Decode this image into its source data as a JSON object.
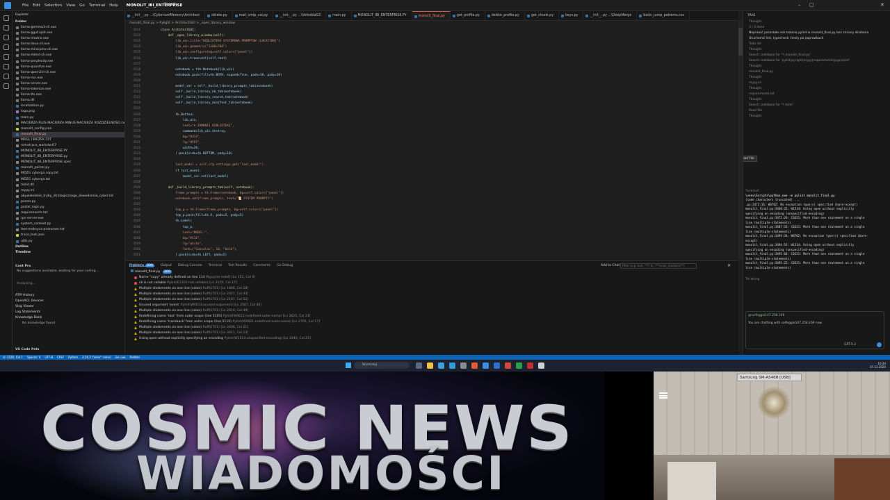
{
  "titlebar": {
    "menus": [
      "File",
      "Edit",
      "Selection",
      "View",
      "Go",
      "Terminal",
      "Help"
    ],
    "project": "MONOLIT_IBI_ENTERPRISE",
    "search": "Search"
  },
  "explorer": {
    "header": "Explorer",
    "folder": "Folder",
    "files": [
      {
        "name": "llama-gemma3-cli.exe",
        "color": "#7a7a7a"
      },
      {
        "name": "llama-gguf-split.exe",
        "color": "#7a7a7a"
      },
      {
        "name": "llama-imatrix.exe",
        "color": "#7a7a7a"
      },
      {
        "name": "llama-llava-cli.exe",
        "color": "#7a7a7a"
      },
      {
        "name": "llama-minicpmv-cli.exe",
        "color": "#7a7a7a"
      },
      {
        "name": "llama-mtmd-cli.exe",
        "color": "#7a7a7a"
      },
      {
        "name": "llama-perplexity.exe",
        "color": "#7a7a7a"
      },
      {
        "name": "llama-quantize.exe",
        "color": "#7a7a7a"
      },
      {
        "name": "llama-qwen2vl-cli.exe",
        "color": "#7a7a7a"
      },
      {
        "name": "llama-run.exe",
        "color": "#7a7a7a"
      },
      {
        "name": "llama-server.exe",
        "color": "#7a7a7a"
      },
      {
        "name": "llama-tokenize.exe",
        "color": "#7a7a7a"
      },
      {
        "name": "llama-tts.exe",
        "color": "#7a7a7a"
      },
      {
        "name": "llama.dll",
        "color": "#7a7a7a"
      },
      {
        "name": "localization.py",
        "color": "#3572a5"
      },
      {
        "name": "logo.png",
        "color": "#a074c4"
      },
      {
        "name": "main.py",
        "color": "#3572a5"
      },
      {
        "name": "MACIERZA PLUS MACIERZA MINUS MACIERZA ROZDZIELNOŚCI.txt",
        "color": "#888"
      },
      {
        "name": "monolit_config.json",
        "color": "#cbcb41"
      },
      {
        "name": "monolit_final.py",
        "color": "#3572a5",
        "selected": true
      },
      {
        "name": "MRGL I BIEŻEK.TXT",
        "color": "#888"
      },
      {
        "name": "mmatryca_wartstw.ft7",
        "color": "#888"
      },
      {
        "name": "MONOLIT_IBI_ENTERPRISE.PY",
        "color": "#3572a5"
      },
      {
        "name": "MONOLIT_IBI_ENTERPRISE.py",
        "color": "#3572a5"
      },
      {
        "name": "MONOLIT_IBI_ENTERPRISE.spec",
        "color": "#888"
      },
      {
        "name": "monolit_parser.py",
        "color": "#3572a5"
      },
      {
        "name": "MÓZG cyborga copy.txt",
        "color": "#888"
      },
      {
        "name": "MÓZG cyborga.txt",
        "color": "#888"
      },
      {
        "name": "mmd.dll",
        "color": "#7a7a7a"
      },
      {
        "name": "mypy.ini",
        "color": "#888"
      },
      {
        "name": "obywatelskie_tryby_strategicznego_dowodzenia_cyber.txt",
        "color": "#888"
      },
      {
        "name": "parser.py",
        "color": "#3572a5"
      },
      {
        "name": "portal_logic.py",
        "color": "#3572a5"
      },
      {
        "name": "requirements.txt",
        "color": "#888"
      },
      {
        "name": "rpc-server.exe",
        "color": "#7a7a7a"
      },
      {
        "name": "system_context.py",
        "color": "#3572a5"
      },
      {
        "name": "test-maksyca-prezunwe.txt",
        "color": "#888"
      },
      {
        "name": "trace_test.json",
        "color": "#cbcb41"
      },
      {
        "name": "utils.py",
        "color": "#3572a5"
      }
    ],
    "outline": "Outline",
    "timeline": "Timeline"
  },
  "copilot": {
    "header": "Cont Pro",
    "message": "No suggestions available, waiting for your coding...",
    "analyzing": "Analyzing...",
    "sections": [
      "ATPI History",
      "OpenACL Devices",
      "Slog Viewer",
      "Log Statements",
      "Knowledge Bank"
    ],
    "knowledge_empty": "No knowledge found",
    "footer": "VS Code Pets"
  },
  "tabs": [
    "__init__.py ...\\CyberiumMemory\\Architect",
    "delete.py",
    "mail_smtp_cal.py",
    "__init__.py ...\\VettoblaG3",
    "main.py",
    "MONOLIT_IBI_ENTERPRISE.PY",
    "monolit_final.py",
    "get_profile.py",
    "delete_profile.py",
    "get_chunk.py",
    "keys.py",
    "__init__.py ...\\DeepMerge",
    "basic_jump_patterns.css"
  ],
  "active_tab_index": 6,
  "breadcrumb": "monolit_final.py > Pylight > ArchitectGUI > _open_library_window",
  "editor": {
    "lines": [
      {
        "n": "3511",
        "t": "        class ArchitectGUI:"
      },
      {
        "n": "3512",
        "t": "            def _open_library_window(self):"
      },
      {
        "n": "3513",
        "t": "                lib_win.title(\"BIBLIOTEKA SYSTEMOWA PROMPTÓW [LOCATION]\")"
      },
      {
        "n": "3514",
        "t": "                lib_win.geometry(\"1100x700\")"
      },
      {
        "n": "3515",
        "t": "                lib_win.configure(bg=self.colors[\"panel\"])"
      },
      {
        "n": "3516",
        "t": "                lib_win.transient(self.root)"
      },
      {
        "n": "3517",
        "t": ""
      },
      {
        "n": "3518",
        "t": "                notebook = ttk.Notebook(lib_win)"
      },
      {
        "n": "3519",
        "t": "                notebook.pack(fill=tk.BOTH, expand=True, padx=10, pady=10)"
      },
      {
        "n": "3520",
        "t": ""
      },
      {
        "n": "3521",
        "t": "                model_var = self._build_library_prompts_tab(notebook)"
      },
      {
        "n": "3522",
        "t": "                self._build_library_kb_tab(notebook)"
      },
      {
        "n": "3523",
        "t": "                self._build_library_search_tab(notebook)"
      },
      {
        "n": "3524",
        "t": "                self._build_library_manifest_tab(notebook)"
      },
      {
        "n": "3525",
        "t": ""
      },
      {
        "n": "3526",
        "t": "                tk.Button("
      },
      {
        "n": "3527",
        "t": "                    lib_win,"
      },
      {
        "n": "3528",
        "t": "                    text=\"✖ ZAMKNIJ BIBLIOTEKĘ\","
      },
      {
        "n": "3529",
        "t": "                    command=lib_win.destroy,"
      },
      {
        "n": "3530",
        "t": "                    bg=\"#333\","
      },
      {
        "n": "3531",
        "t": "                    fg=\"#FFF\","
      },
      {
        "n": "3532",
        "t": "                    width=20,"
      },
      {
        "n": "3533",
        "t": "                ).pack(side=tk.BOTTOM, pady=10)"
      },
      {
        "n": "3534",
        "t": ""
      },
      {
        "n": "3535",
        "t": "                last_model = self.cfg.settings.get(\"last_model\")"
      },
      {
        "n": "3536",
        "t": "                if last_model:"
      },
      {
        "n": "3537",
        "t": "                    model_var.set(last_model)"
      },
      {
        "n": "3538",
        "t": ""
      },
      {
        "n": "3539",
        "t": "            def _build_library_prompts_tab(self, notebook):"
      },
      {
        "n": "3540",
        "t": "                frame_prompts = tk.Frame(notebook, bg=self.colors[\"panel\"])"
      },
      {
        "n": "3541",
        "t": "                notebook.add(frame_prompts, text=\"📜 SYSTEM PROMPTY\")"
      },
      {
        "n": "3542",
        "t": ""
      },
      {
        "n": "3543",
        "t": "                top_p = tk.Frame(frame_prompts, bg=self.colors[\"panel\"])"
      },
      {
        "n": "3544",
        "t": "                top_p.pack(fill=tk.X, padx=5, pady=5)"
      },
      {
        "n": "3545",
        "t": "                tk.Label("
      },
      {
        "n": "3546",
        "t": "                    top_p,"
      },
      {
        "n": "3547",
        "t": "                    text=\"MODEL:\","
      },
      {
        "n": "3548",
        "t": "                    bg=\"#111\","
      },
      {
        "n": "3549",
        "t": "                    fg=\"white\","
      },
      {
        "n": "3550",
        "t": "                    font=(\"Consolas\", 10, \"bold\"),"
      },
      {
        "n": "3551",
        "t": "                ).pack(side=tk.LEFT, padx=5)"
      }
    ]
  },
  "panel": {
    "tabs": [
      "Problems",
      "Output",
      "Debug Console",
      "Terminal",
      "Test Results",
      "Comments",
      "Go Debug"
    ],
    "problem_count": "200",
    "add_to_chat": "Add to Chat",
    "filter_placeholder": "Filter (e.g. text, **/*.ts, !**/node_modules/**)",
    "file_header": "monolit_final.py",
    "file_count": "200",
    "problems": [
      {
        "sev": "err",
        "msg": "Name \"copy\" already defined on line 114",
        "meta": "Mypy(no-redef) [Ln 152, Col 9]"
      },
      {
        "sev": "err",
        "msg": "cb is not callable",
        "meta": "Pylint(E1102:not-callable) [Ln 2070, Col 17]"
      },
      {
        "sev": "warn",
        "msg": "Multiple statements on one line (colon)",
        "meta": "Ruff(E701) [Ln 1866, Col 28]"
      },
      {
        "sev": "warn",
        "msg": "Multiple statements on one line (colon)",
        "meta": "Ruff(E701) [Ln 2007, Col 44]"
      },
      {
        "sev": "warn",
        "msg": "Multiple statements on one line (colon)",
        "meta": "Ruff(E701) [Ln 2197, Col 52]"
      },
      {
        "sev": "warn",
        "msg": "Unused argument 'event'",
        "meta": "Pylint(W0613:unused-argument) [Ln 2587, Col 40]"
      },
      {
        "sev": "warn",
        "msg": "Multiple statements on one line (colon)",
        "meta": "Ruff(E701) [Ln 2610, Col 49]"
      },
      {
        "sev": "warn",
        "msg": "Redefining name 'root' from outer scope (line 5105)",
        "meta": "Pylint(W0621:redefined-outer-name) [Ln 2625, Col 23]"
      },
      {
        "sev": "warn",
        "msg": "Redefining name 'traceback' from outer scope (line 5115)",
        "meta": "Pylint(W0621:redefined-outer-name) [Ln 2705, Col 17]"
      },
      {
        "sev": "warn",
        "msg": "Multiple statements on one line (colon)",
        "meta": "Ruff(E701) [Ln 3406, Col 21]"
      },
      {
        "sev": "warn",
        "msg": "Multiple statements on one line (colon)",
        "meta": "Ruff(E701) [Ln 3421, Col 24]"
      },
      {
        "sev": "warn",
        "msg": "Using open without explicitly specifying an encoding",
        "meta": "Pylint(W1514:unspecified-encoding) [Ln 3440, Col 25]"
      }
    ]
  },
  "chat": {
    "header": "TRAE",
    "lines": [
      "Thought",
      "3 / 3 done",
      "Naprawić pozostałe ostrzeżenia pylint w monolit_final.py bez zmiany działania",
      "Uruchomić lint, typecheck i testy po poprawkach",
      "Todo list",
      "Thought",
      "Search codebase for '*\\.monolit_final.py'",
      "Search codebase for 'pylint|pyright|mypy|requirements|pyproject'",
      "Thought",
      "monolit_final.py",
      "Thought",
      "mypy.ini",
      "Thought",
      "requirements.txt",
      "Thought",
      "Search codebase for '*\\.toml'",
      "Read file",
      "Thought"
    ],
    "term_title": "Terminal",
    "term_cmd": "\\venv\\Scripts\\python.exe -m pylint monolit_final.py",
    "term_lines": [
      "(some characters truncated) ...",
      ".py:3472:16: W0702: No exception type(s) specified (bare-except)",
      "monolit_final.py:3460:25: W1514: Using open without explicitly",
      "specifying an encoding (unspecified-encoding)",
      "monolit_final.py:3472:26: C0321: More than one statement on a single",
      "line (multiple-statements)",
      "monolit_final.py:3487:33: C0321: More than one statement on a single",
      "line (multiple-statements)",
      "monolit_final.py:3494:34: W0702: No exception type(s) specified (bare-",
      "except)",
      "monolit_final.py:3494:55: W1514: Using open without explicitly",
      "specifying an encoding (unspecified-encoding)",
      "monolit_final.py:3495:64: C0321: More than one statement on a single",
      "line (multiple-statements)",
      "monolit_final.py:3495:22: C0321: More than one statement on a single",
      "line (multiple-statements)"
    ],
    "thinking": "Thinking",
    "tooltip": "Read File",
    "account": "@solfeggio147.258.169",
    "chatting": "You are chatting with solfeggio147.258.169 now",
    "model": "GPT-5.2"
  },
  "statusbar": [
    "Ln 3520, Col 1",
    "Spaces: 4",
    "UTF-8",
    "CRLF",
    "Python",
    "3.14.2 ('venv': venv)",
    "Go Live",
    "Prettier"
  ],
  "taskbar": {
    "search": "Wyszukaj",
    "time": "10:34",
    "date": "07.12.2024"
  },
  "video": {
    "title_line1": "COSMIC NEWS",
    "title_line2": "WIADOMOŚCI"
  },
  "camera": {
    "label": "Samsung SM-A546B [USB]"
  }
}
